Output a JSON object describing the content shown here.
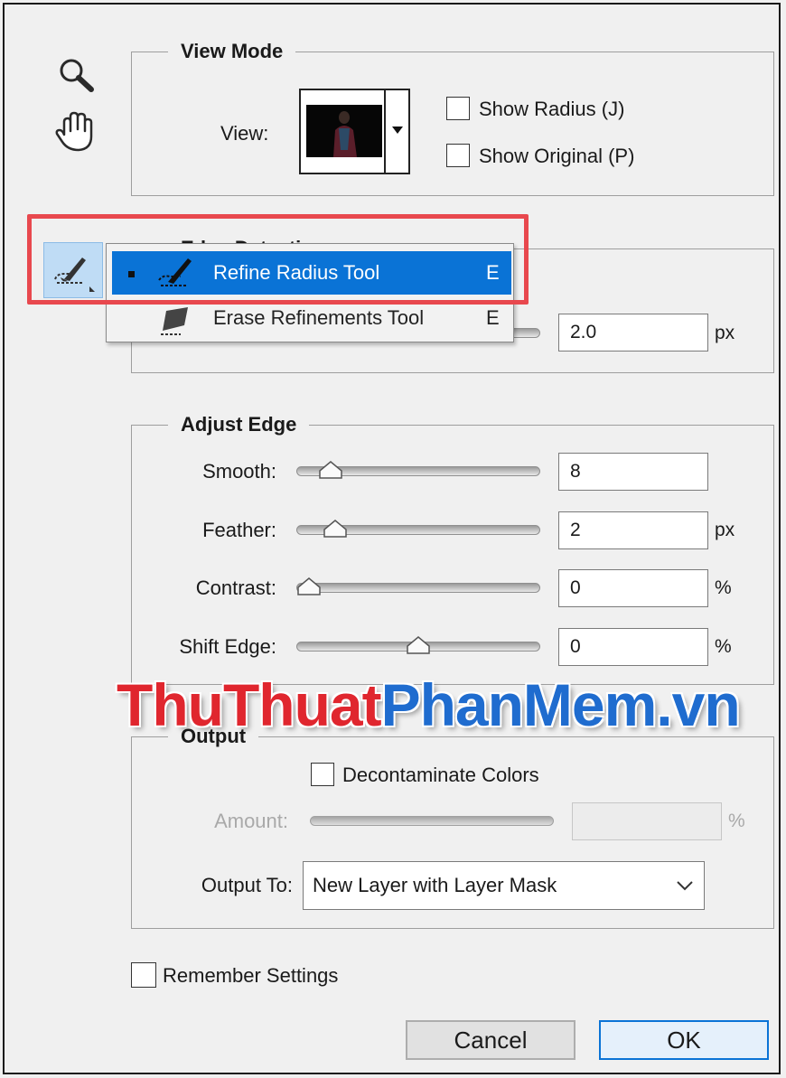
{
  "tools": {
    "zoom_icon": "zoom-icon",
    "hand_icon": "hand-icon",
    "refine_brush_icon": "refine-radius-brush-icon"
  },
  "view_mode": {
    "legend": "View Mode",
    "view_label": "View:",
    "show_radius": {
      "label": "Show Radius (J)",
      "checked": false
    },
    "show_original": {
      "label": "Show Original (P)",
      "checked": false
    }
  },
  "tool_menu": {
    "items": [
      {
        "label": "Refine Radius Tool",
        "shortcut": "E",
        "selected": true
      },
      {
        "label": "Erase Refinements Tool",
        "shortcut": "E",
        "selected": false
      }
    ]
  },
  "edge_detection": {
    "legend": "Edge Detection",
    "radius_value": "2.0",
    "radius_unit": "px"
  },
  "adjust_edge": {
    "legend": "Adjust Edge",
    "rows": [
      {
        "label": "Smooth:",
        "value": "8",
        "unit": "",
        "level": 0.1
      },
      {
        "label": "Feather:",
        "value": "2",
        "unit": "px",
        "level": 0.12
      },
      {
        "label": "Contrast:",
        "value": "0",
        "unit": "%",
        "level": 0.0
      },
      {
        "label": "Shift Edge:",
        "value": "0",
        "unit": "%",
        "level": 0.5
      }
    ]
  },
  "watermark": {
    "part1": "ThuThuat",
    "part2": "PhanMem.vn"
  },
  "output": {
    "legend": "Output",
    "decontaminate_label": "Decontaminate Colors",
    "amount_label": "Amount:",
    "amount_unit": "%",
    "output_to_label": "Output To:",
    "output_to_value": "New Layer with Layer Mask"
  },
  "remember_settings": "Remember Settings",
  "buttons": {
    "cancel": "Cancel",
    "ok": "OK"
  },
  "colors": {
    "selection": "#0a73d6",
    "highlight_box": "#e8484e",
    "watermark_red": "#e0262e",
    "watermark_blue": "#1f6ccf"
  }
}
